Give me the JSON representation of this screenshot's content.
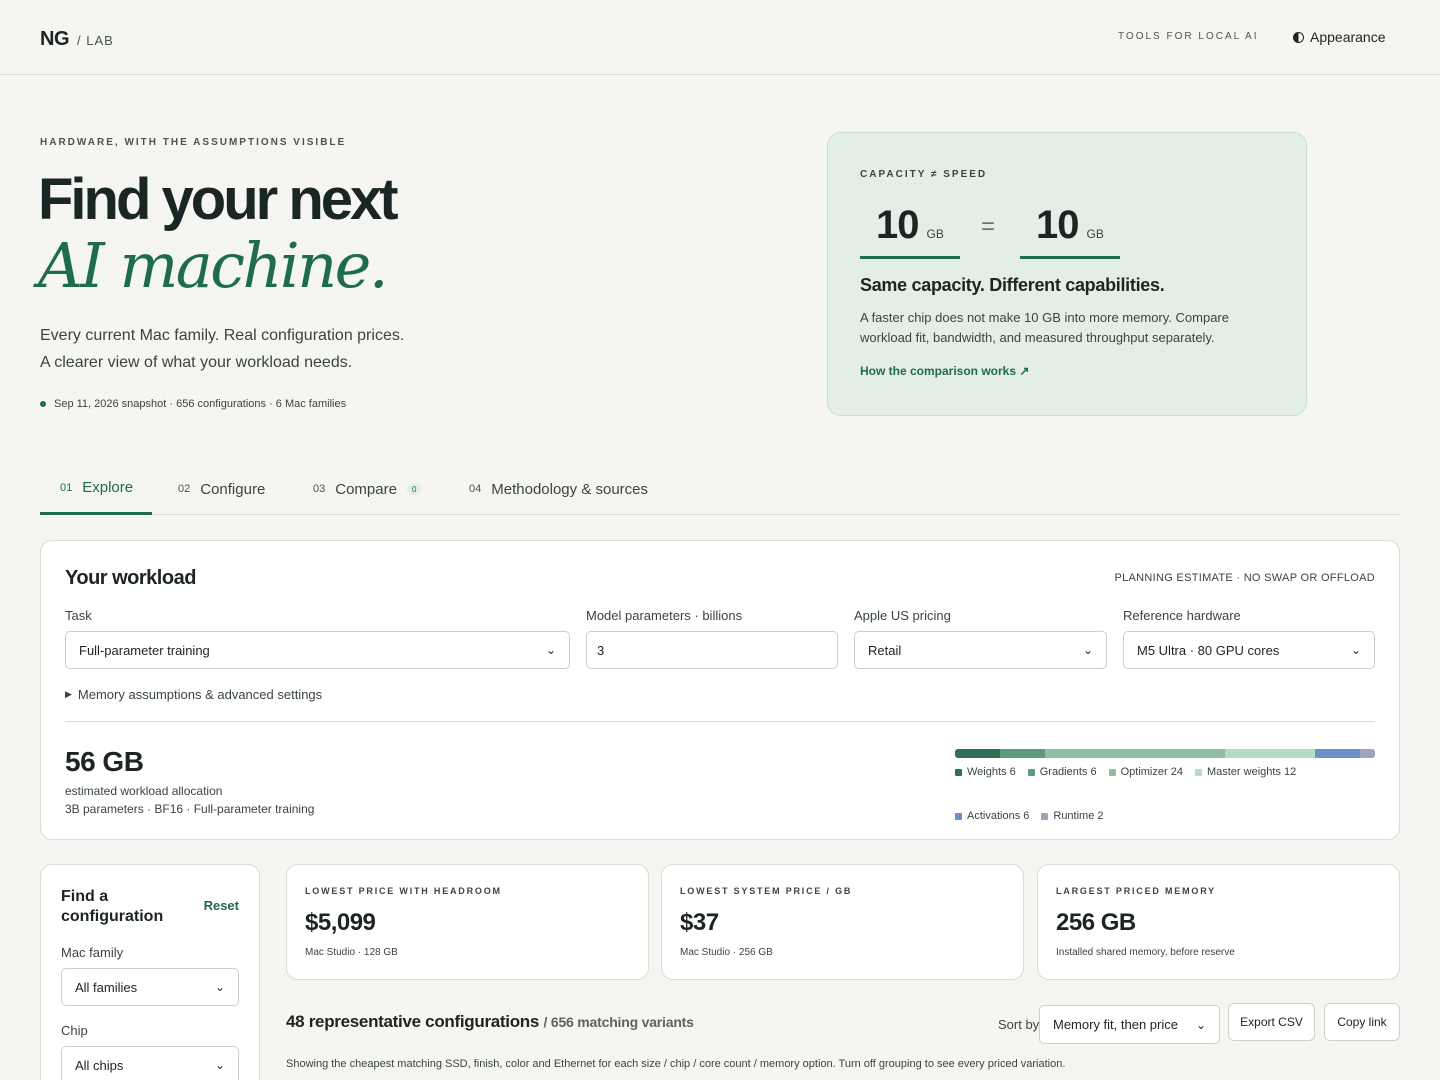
{
  "header": {
    "logo": "NG",
    "logo_sub": "/ LAB",
    "tagline": "TOOLS FOR LOCAL AI",
    "appearance_label": "Appearance"
  },
  "hero": {
    "eyebrow": "HARDWARE, WITH THE ASSUMPTIONS VISIBLE",
    "title_line1": "Find your next",
    "title_line2": "AI machine.",
    "lede_line1": "Every current Mac family. Real configuration prices.",
    "lede_line2": "A clearer view of what your workload needs.",
    "snapshot": "Sep 11, 2026 snapshot · 656 configurations · 6 Mac families"
  },
  "capacity_card": {
    "eyebrow": "CAPACITY ≠ SPEED",
    "left_value": "10",
    "left_unit": "GB",
    "equals": "=",
    "right_value": "10",
    "right_unit": "GB",
    "title": "Same capacity. Different capabilities.",
    "body": "A faster chip does not make 10 GB into more memory. Compare workload fit, bandwidth, and measured throughput separately.",
    "link": "How the comparison works ↗"
  },
  "tabs": [
    {
      "num": "01",
      "label": "Explore"
    },
    {
      "num": "02",
      "label": "Configure"
    },
    {
      "num": "03",
      "label": "Compare",
      "badge": "0"
    },
    {
      "num": "04",
      "label": "Methodology & sources"
    }
  ],
  "workload": {
    "title": "Your workload",
    "note": "PLANNING ESTIMATE · NO SWAP OR OFFLOAD",
    "task_label": "Task",
    "task_value": "Full-parameter training",
    "params_label": "Model parameters · billions",
    "params_value": "3",
    "pricing_label": "Apple US pricing",
    "pricing_value": "Retail",
    "reference_label": "Reference hardware",
    "reference_value": "M5 Ultra · 80 GPU cores",
    "advanced": "Memory assumptions & advanced settings",
    "total": "56 GB",
    "total_label": "estimated workload allocation",
    "total_detail": "3B parameters · BF16 · Full-parameter training",
    "breakdown": [
      {
        "label": "Weights 6",
        "value": 6,
        "color": "#2f6f55"
      },
      {
        "label": "Gradients 6",
        "value": 6,
        "color": "#5e9a7e"
      },
      {
        "label": "Optimizer 24",
        "value": 24,
        "color": "#8fbf9f"
      },
      {
        "label": "Master weights 12",
        "value": 12,
        "color": "#b6dbbf"
      },
      {
        "label": "Activations 6",
        "value": 6,
        "color": "#6a8fc9"
      },
      {
        "label": "Runtime 2",
        "value": 2,
        "color": "#9aa5b8"
      }
    ]
  },
  "finder": {
    "title": "Find a configuration",
    "reset": "Reset",
    "family_label": "Mac family",
    "family_value": "All families",
    "chip_label": "Chip",
    "chip_value": "All chips"
  },
  "stats": [
    {
      "eyebrow": "LOWEST PRICE WITH HEADROOM",
      "value": "$5,099",
      "sub": "Mac Studio · 128 GB"
    },
    {
      "eyebrow": "LOWEST SYSTEM PRICE / GB",
      "value": "$37",
      "sub": "Mac Studio · 256 GB"
    },
    {
      "eyebrow": "LARGEST PRICED MEMORY",
      "value": "256 GB",
      "sub": "Installed shared memory, before reserve"
    }
  ],
  "results": {
    "title": "48 representative configurations",
    "subtitle": "/ 656 matching variants",
    "sort_label": "Sort by",
    "sort_value": "Memory fit, then price",
    "export": "Export CSV",
    "copy": "Copy link",
    "note": "Showing the cheapest matching SSD, finish, color and Ethernet for each size / chip / core count / memory option. Turn off grouping to see every priced variation."
  }
}
